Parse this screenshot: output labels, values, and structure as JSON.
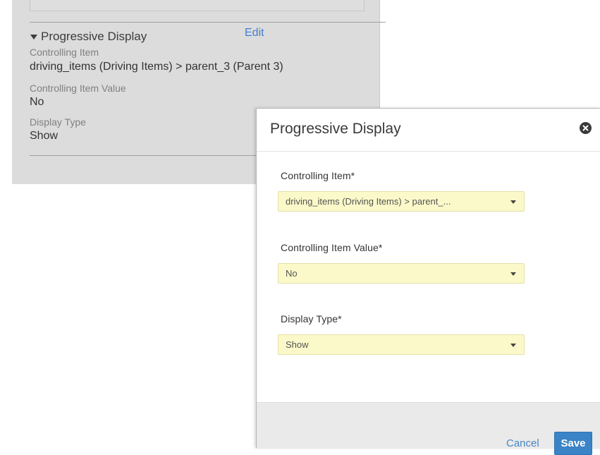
{
  "background_panel": {
    "section_title": "Progressive Display",
    "edit_label": "Edit",
    "fields": [
      {
        "label": "Controlling Item",
        "value": "driving_items (Driving Items) > parent_3 (Parent 3)"
      },
      {
        "label": "Controlling Item Value",
        "value": "No"
      },
      {
        "label": "Display Type",
        "value": "Show"
      }
    ]
  },
  "dialog": {
    "title": "Progressive Display",
    "close_icon": "close-circle-icon",
    "fields": [
      {
        "label": "Controlling Item*",
        "value": "driving_items (Driving Items) > parent_..."
      },
      {
        "label": "Controlling Item Value*",
        "value": "No"
      },
      {
        "label": "Display Type*",
        "value": "Show"
      }
    ],
    "cancel_label": "Cancel",
    "save_label": "Save"
  },
  "colors": {
    "field_highlight": "#fbf9c9",
    "primary_button": "#3a83c6",
    "link": "#3f7fd0"
  }
}
